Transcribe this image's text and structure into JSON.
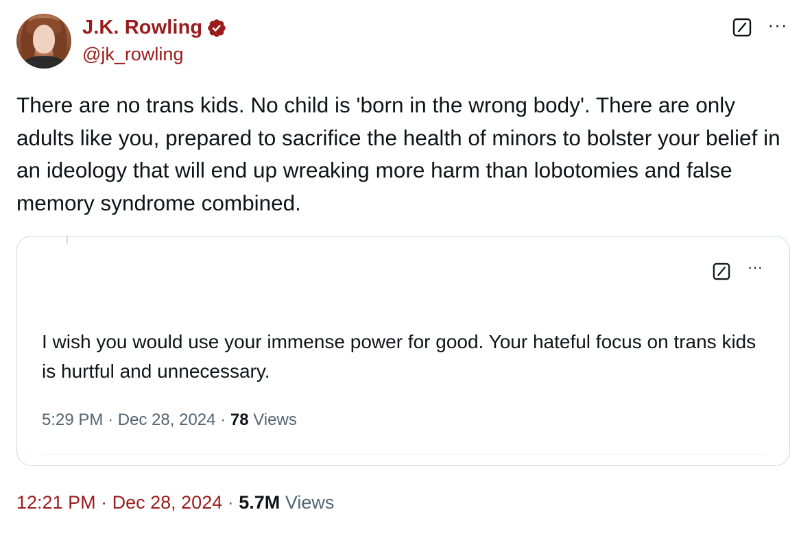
{
  "author": {
    "display_name": "J.K. Rowling",
    "handle": "@jk_rowling",
    "verified": true
  },
  "tweet": {
    "text": "There are no trans kids. No child is 'born in the wrong body'. There are only adults like you, prepared to sacrifice the health of minors to bolster your belief in an ideology that will end up wreaking more harm than lobotomies and false memory syndrome combined.",
    "time": "12:21 PM",
    "date": "Dec 28, 2024",
    "views_count": "5.7M",
    "views_label": "Views"
  },
  "quoted_tweet": {
    "text": "I wish you would use your immense power for good. Your hateful focus on trans kids is hurtful and unnecessary.",
    "time": "5:29 PM",
    "date": "Dec 28, 2024",
    "views_count": "78",
    "views_label": "Views"
  },
  "icons": {
    "verified": "verified-badge-icon",
    "grok": "grok-icon",
    "more": "more-icon"
  },
  "colors": {
    "name_accent": "#9a1b1b",
    "text": "#0f1419",
    "muted": "#536471",
    "border": "#cfd9de"
  },
  "separator": "·",
  "more_glyph": "···"
}
